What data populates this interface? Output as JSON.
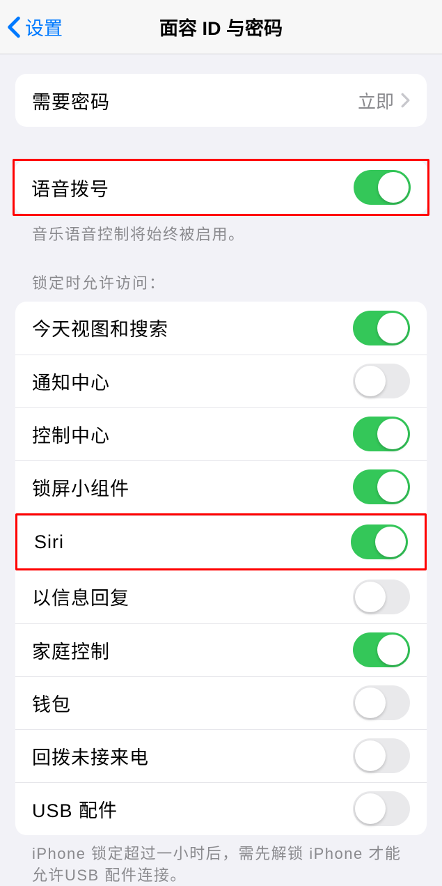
{
  "nav": {
    "back": "设置",
    "title": "面容 ID 与密码"
  },
  "passcode": {
    "label": "需要密码",
    "value": "立即"
  },
  "voiceDial": {
    "label": "语音拨号",
    "on": true,
    "footer": "音乐语音控制将始终被启用。"
  },
  "lockedAccess": {
    "header": "锁定时允许访问：",
    "items": [
      {
        "label": "今天视图和搜索",
        "on": true
      },
      {
        "label": "通知中心",
        "on": false
      },
      {
        "label": "控制中心",
        "on": true
      },
      {
        "label": "锁屏小组件",
        "on": true
      },
      {
        "label": "Siri",
        "on": true,
        "highlighted": true
      },
      {
        "label": "以信息回复",
        "on": false
      },
      {
        "label": "家庭控制",
        "on": true
      },
      {
        "label": "钱包",
        "on": false
      },
      {
        "label": "回拨未接来电",
        "on": false
      },
      {
        "label": "USB 配件",
        "on": false
      }
    ],
    "footer": "iPhone 锁定超过一小时后，需先解锁 iPhone 才能允许USB 配件连接。"
  }
}
